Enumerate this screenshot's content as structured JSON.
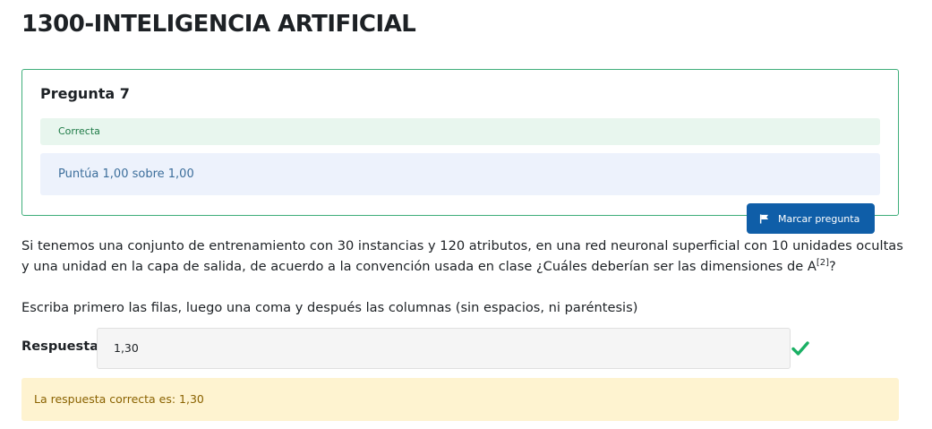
{
  "course": {
    "title": "1300-INTELIGENCIA ARTIFICIAL"
  },
  "question": {
    "number_label": "Pregunta 7",
    "state": "Correcta",
    "grade": "Puntúa 1,00 sobre 1,00",
    "flag_label": "Marcar pregunta",
    "text_before_sup": "Si tenemos una conjunto de entrenamiento con 30 instancias y 120 atributos, en una red neuronal superficial con 10 unidades ocultas y una unidad en la capa de salida, de acuerdo a la convención usada en clase ¿Cuáles deberían ser las dimensiones de A",
    "text_sup": "[2]",
    "text_after_sup": "?",
    "instructions": "Escriba primero las filas, luego una coma y después las columnas (sin espacios, ni paréntesis)",
    "answer_label": "Respuesta:",
    "answer_value": "1,30",
    "feedback": "La respuesta correcta es: 1,30"
  },
  "colors": {
    "success": "#1ab064",
    "flag_button": "#0f5ea8",
    "feedback_bg": "#fef3d0"
  },
  "icons": {
    "flag": "flag-icon",
    "correct": "checkmark-icon"
  }
}
